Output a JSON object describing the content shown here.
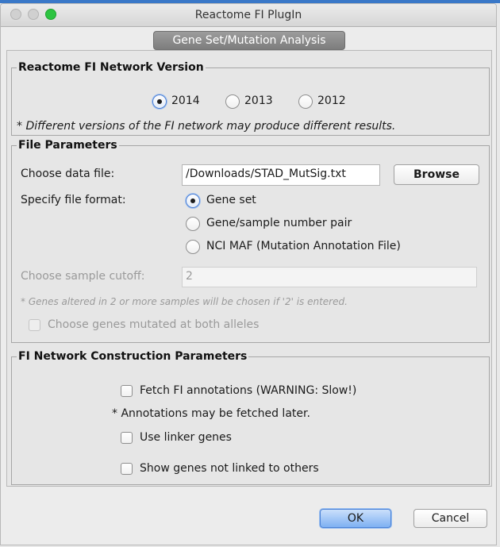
{
  "window": {
    "title": "Reactome FI PlugIn"
  },
  "tab": {
    "label": "Gene Set/Mutation Analysis"
  },
  "network_version": {
    "legend": "Reactome FI Network Version",
    "options": [
      {
        "label": "2014",
        "selected": true
      },
      {
        "label": "2013",
        "selected": false
      },
      {
        "label": "2012",
        "selected": false
      }
    ],
    "note": "* Different versions of the FI network may produce different results."
  },
  "file_params": {
    "legend": "File Parameters",
    "data_file_label": "Choose data file:",
    "data_file_value": "/Downloads/STAD_MutSig.txt",
    "browse_label": "Browse",
    "format_label": "Specify file format:",
    "formats": [
      {
        "label": "Gene set",
        "selected": true
      },
      {
        "label": "Gene/sample number pair",
        "selected": false
      },
      {
        "label": "NCI MAF (Mutation Annotation File)",
        "selected": false
      }
    ],
    "cutoff_label": "Choose sample cutoff:",
    "cutoff_value": "2",
    "cutoff_note": "* Genes altered in 2 or more samples will be chosen if '2' is entered.",
    "both_alleles_label": "Choose genes mutated at both alleles"
  },
  "construction": {
    "legend": "FI Network Construction Parameters",
    "fetch_label": "Fetch FI annotations (WARNING: Slow!)",
    "fetch_note": "* Annotations may be fetched later.",
    "linker_label": "Use linker genes",
    "unlinked_label": "Show genes not linked to others"
  },
  "buttons": {
    "ok": "OK",
    "cancel": "Cancel"
  },
  "colors": {
    "accent": "#4a7fd6",
    "zoom": "#2dc441",
    "tab": "#8a8a8a"
  }
}
